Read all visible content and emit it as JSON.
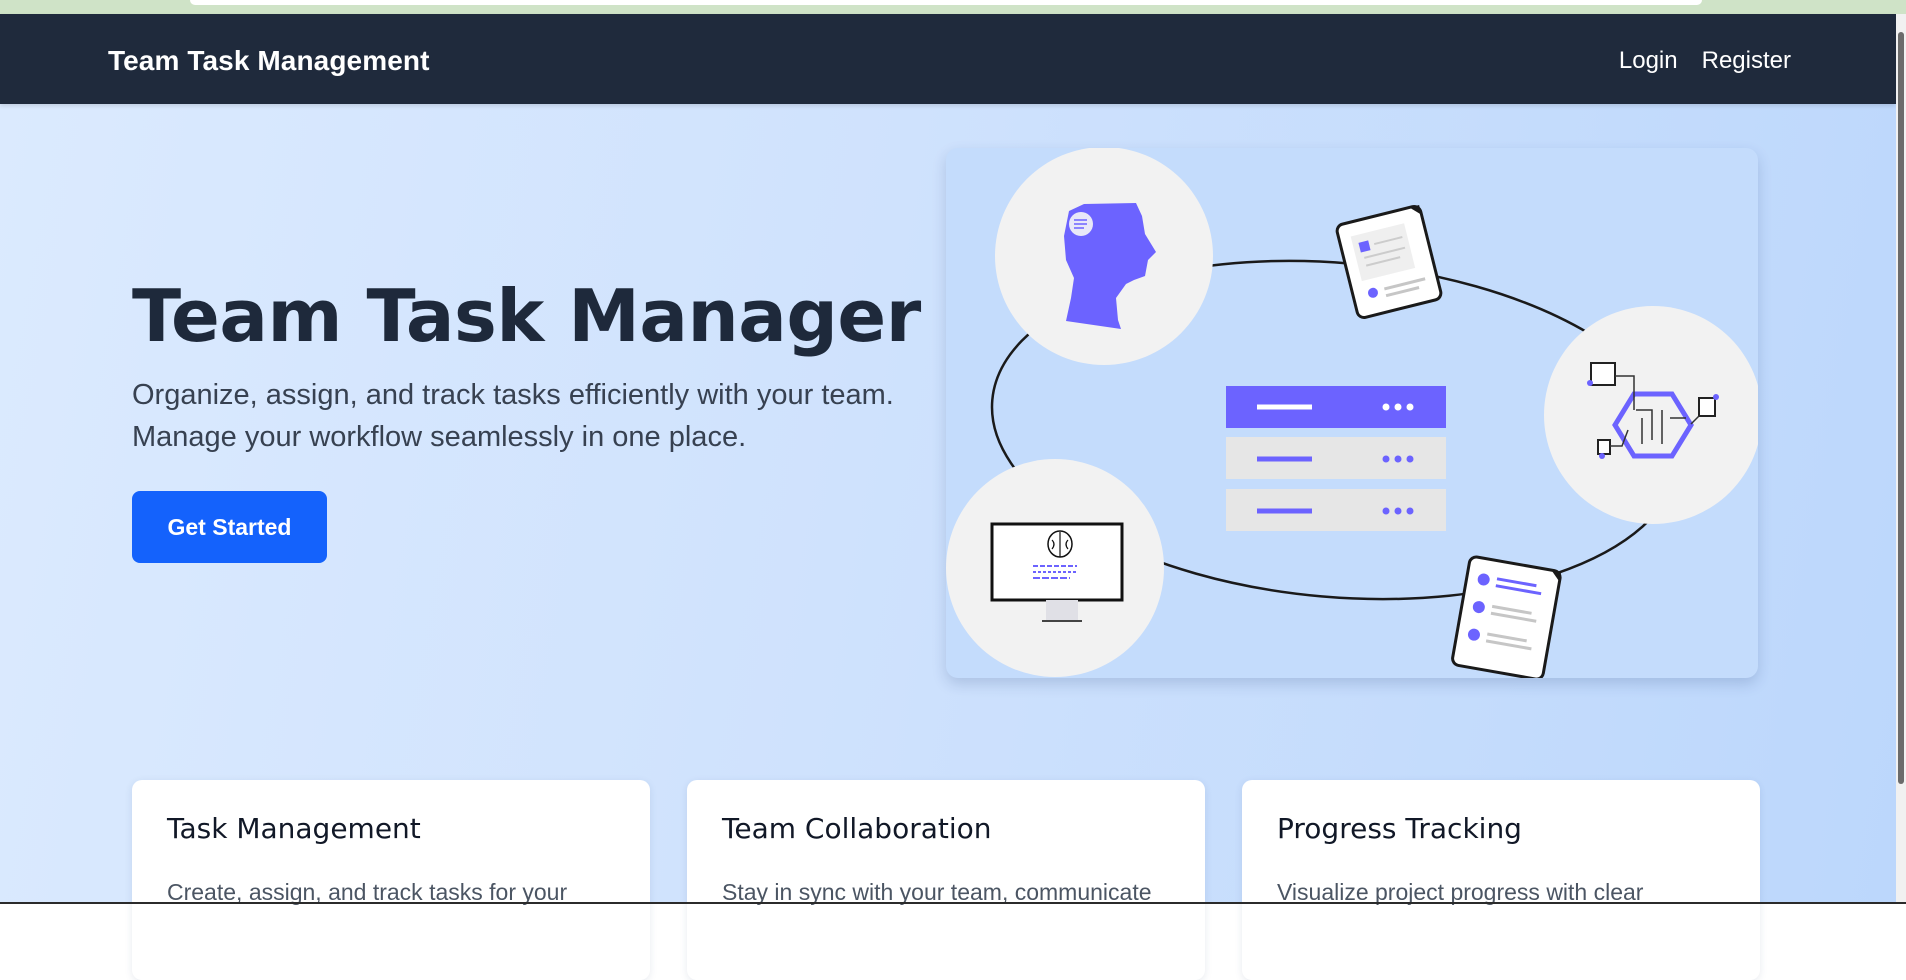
{
  "navbar": {
    "brand": "Team Task Management",
    "links": [
      "Login",
      "Register"
    ]
  },
  "hero": {
    "title": "Team Task Manager",
    "subtitle": "Organize, assign, and track tasks efficiently with your team. Manage your workflow seamlessly in one place.",
    "cta_label": "Get Started"
  },
  "illustration": {
    "icons": [
      "person-head-icon",
      "document-icon",
      "circuit-hexagon-icon",
      "monitor-brain-icon",
      "checklist-icon",
      "server-list-icon"
    ]
  },
  "features": [
    {
      "title": "Task Management",
      "text": "Create, assign, and track tasks for your"
    },
    {
      "title": "Team Collaboration",
      "text": "Stay in sync with your team, communicate"
    },
    {
      "title": "Progress Tracking",
      "text": "Visualize project progress with clear"
    }
  ],
  "colors": {
    "navbar": "#1f2a3c",
    "accent": "#1462fc",
    "illustration_purple": "#6c63ff",
    "hero_bg_start": "#dbeafe",
    "hero_bg_end": "#bcd7fc"
  }
}
